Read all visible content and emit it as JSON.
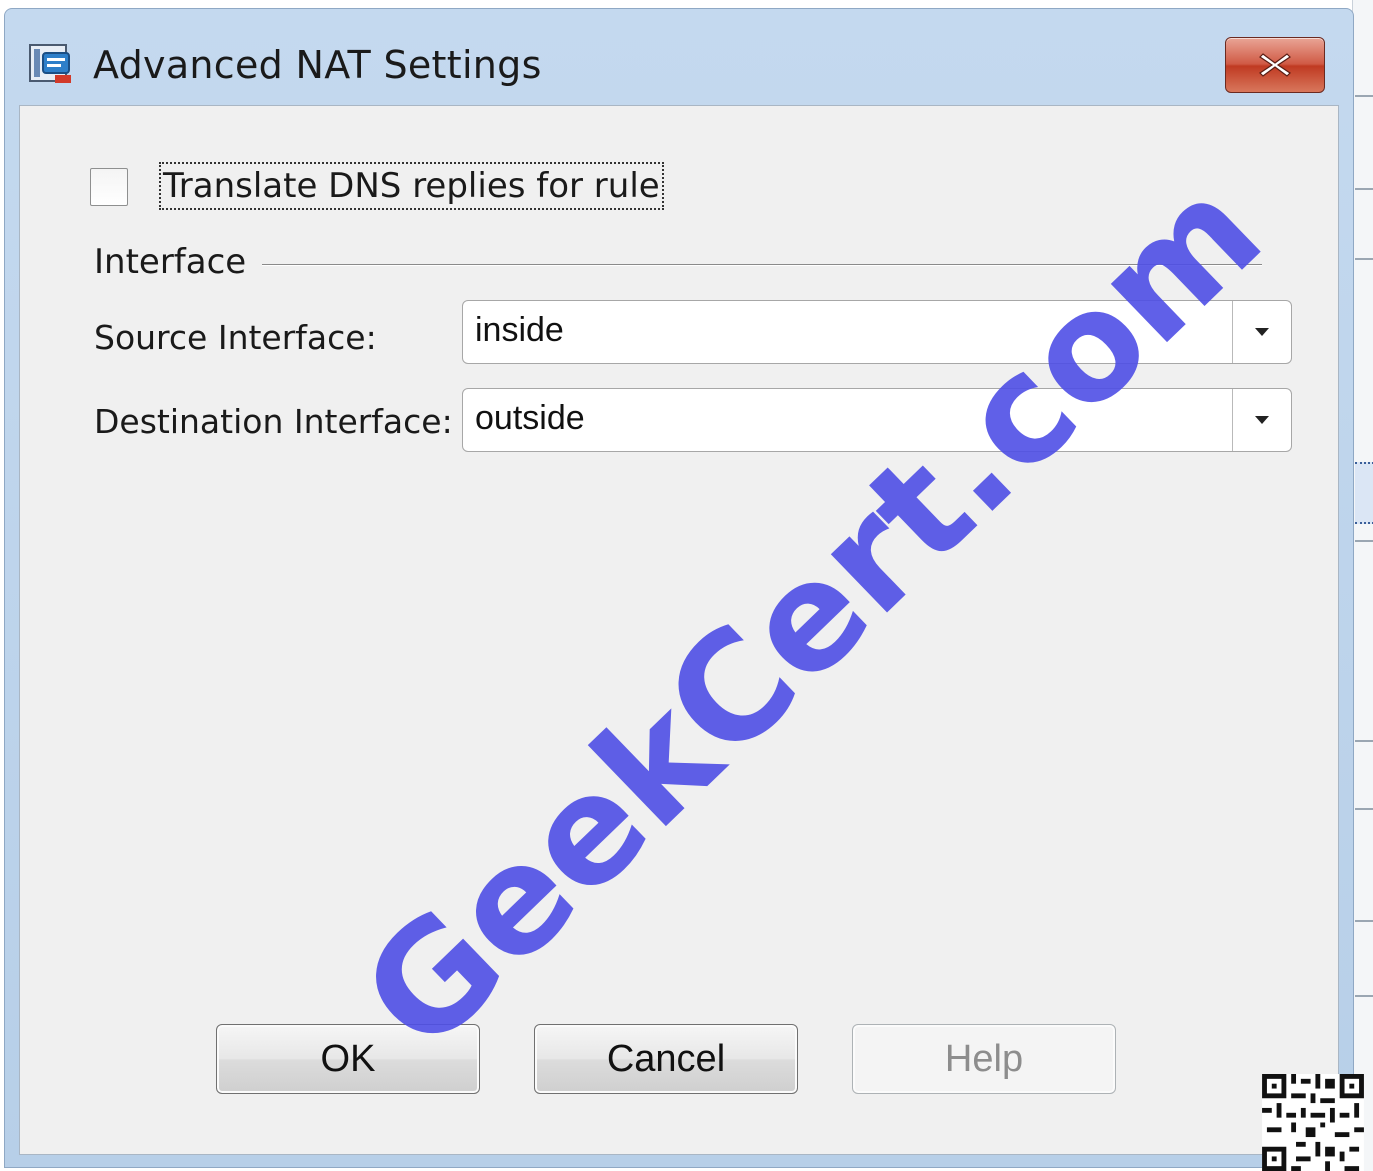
{
  "window": {
    "title": "Advanced NAT Settings",
    "close_icon": "close-icon"
  },
  "options": {
    "translate_dns_label": "Translate DNS replies for rule",
    "translate_dns_checked": false
  },
  "interface_group": {
    "title": "Interface",
    "source_label": "Source Interface:",
    "source_value": "inside",
    "destination_label": "Destination Interface:",
    "destination_value": "outside"
  },
  "buttons": {
    "ok": "OK",
    "cancel": "Cancel",
    "help": "Help"
  },
  "watermark": {
    "text": "GeekCert.com",
    "color": "#4f4fe6"
  },
  "colors": {
    "close_button": "#c03a22",
    "titlebar": "#c4d9ef"
  }
}
